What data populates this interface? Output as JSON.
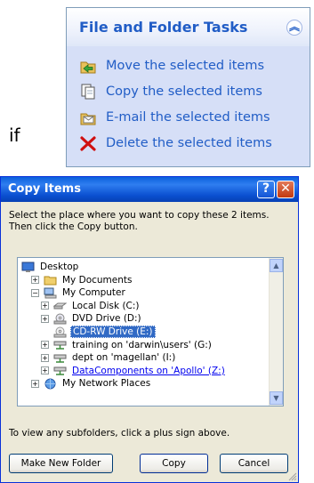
{
  "tasks_panel": {
    "title": "File and Folder Tasks",
    "items": [
      {
        "label": "Move the selected items",
        "icon": "move-icon"
      },
      {
        "label": "Copy the selected items",
        "icon": "copy-icon"
      },
      {
        "label": "E-mail the selected items",
        "icon": "email-icon"
      },
      {
        "label": "Delete the selected items",
        "icon": "delete-icon"
      }
    ]
  },
  "side_text": "if",
  "dialog": {
    "title": "Copy Items",
    "help_glyph": "?",
    "close_glyph": "✕",
    "instruction": "Select the place where you want to copy these 2 items. Then click the Copy button.",
    "tree": [
      {
        "label": "Desktop",
        "icon": "desktop-icon",
        "level": 0,
        "expander": ""
      },
      {
        "label": "My Documents",
        "icon": "folder-icon",
        "level": 1,
        "expander": "+"
      },
      {
        "label": "My Computer",
        "icon": "computer-icon",
        "level": 1,
        "expander": "−"
      },
      {
        "label": "Local Disk (C:)",
        "icon": "hard-disk-icon",
        "level": 2,
        "expander": "+"
      },
      {
        "label": "DVD Drive (D:)",
        "icon": "dvd-drive-icon",
        "level": 2,
        "expander": "+"
      },
      {
        "label": "CD-RW Drive (E:)",
        "icon": "cd-drive-icon",
        "level": 2,
        "expander": "",
        "selected": true
      },
      {
        "label": "training on 'darwin\\users' (G:)",
        "icon": "network-drive-icon",
        "level": 2,
        "expander": "+"
      },
      {
        "label": "dept on 'magellan' (I:)",
        "icon": "network-drive-icon",
        "level": 2,
        "expander": "+"
      },
      {
        "label": "DataComponents on 'Apollo' (Z:)",
        "icon": "network-drive-icon",
        "level": 2,
        "expander": "+",
        "link": true
      },
      {
        "label": "My Network Places",
        "icon": "network-places-icon",
        "level": 1,
        "expander": "+"
      }
    ],
    "hint": "To view any subfolders, click a plus sign above.",
    "buttons": {
      "make_new_folder": "Make New Folder",
      "copy": "Copy",
      "cancel": "Cancel"
    }
  }
}
